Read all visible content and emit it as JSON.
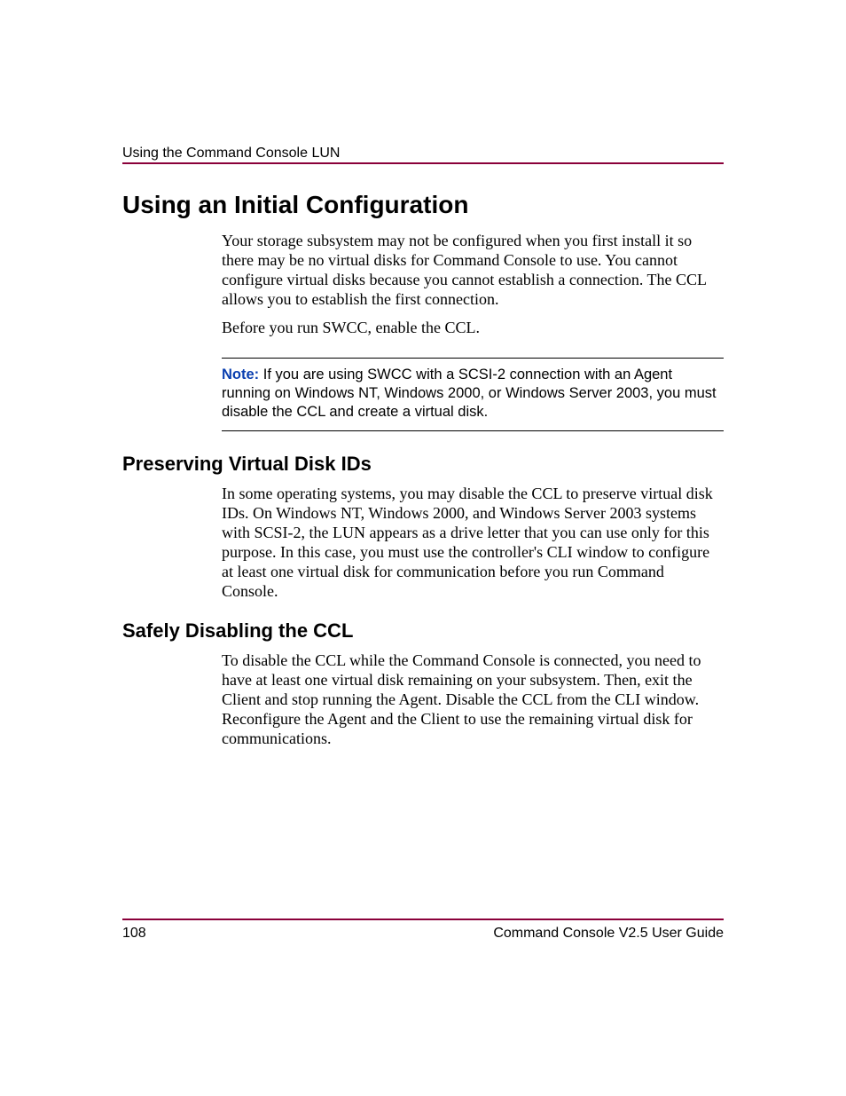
{
  "header": {
    "running_title": "Using the Command Console LUN"
  },
  "main": {
    "h1": "Using an Initial Configuration",
    "p1": "Your storage subsystem may not be configured when you first install it so there may be no virtual disks for Command Console to use. You cannot configure virtual disks because you cannot establish a connection. The CCL allows you to establish the first connection.",
    "p2": "Before you run SWCC, enable the CCL.",
    "note": {
      "label": "Note:",
      "text": " If you are using SWCC with a SCSI-2 connection with an Agent running on Windows NT, Windows 2000, or Windows Server 2003, you must disable the CCL and create a virtual disk."
    },
    "sub1": {
      "title": "Preserving Virtual Disk IDs",
      "body": "In some operating systems, you may disable the CCL to preserve virtual disk IDs. On Windows NT, Windows 2000, and Windows Server 2003 systems with SCSI-2, the LUN appears as a drive letter that you can use only for this purpose. In this case, you must use the controller's CLI window to configure at least one virtual disk for communication before you run Command Console."
    },
    "sub2": {
      "title": "Safely Disabling the CCL",
      "body": "To disable the CCL while the Command Console is connected, you need to have at least one virtual disk remaining on your subsystem. Then, exit the Client and stop running the Agent. Disable the CCL from the CLI window. Reconfigure the Agent and the Client to use the remaining virtual disk for communications."
    }
  },
  "footer": {
    "page_number": "108",
    "guide_title": "Command Console V2.5 User Guide"
  }
}
